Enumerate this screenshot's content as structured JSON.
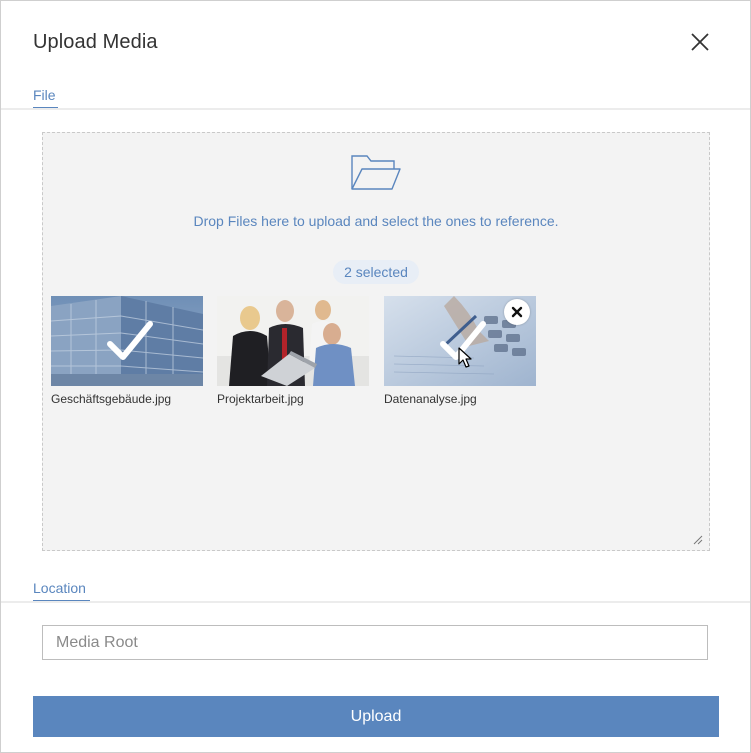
{
  "dialog": {
    "title": "Upload Media",
    "close_icon": "close-icon"
  },
  "tabs": {
    "file": "File",
    "location": "Location"
  },
  "dropzone": {
    "folder_icon": "folder-open-icon",
    "prompt": "Drop Files here to upload and select the ones to reference.",
    "selected_count": "2 selected",
    "files": [
      {
        "name": "Geschäftsgebäude.jpg",
        "selected": true
      },
      {
        "name": "Projektarbeit.jpg",
        "selected": false
      },
      {
        "name": "Datenanalyse.jpg",
        "selected": true
      }
    ]
  },
  "location": {
    "placeholder": "Media Root",
    "value": ""
  },
  "actions": {
    "upload_label": "Upload"
  },
  "colors": {
    "accent": "#5a86be",
    "dropzone_bg": "#f3f3f3",
    "divider": "#ececec"
  }
}
